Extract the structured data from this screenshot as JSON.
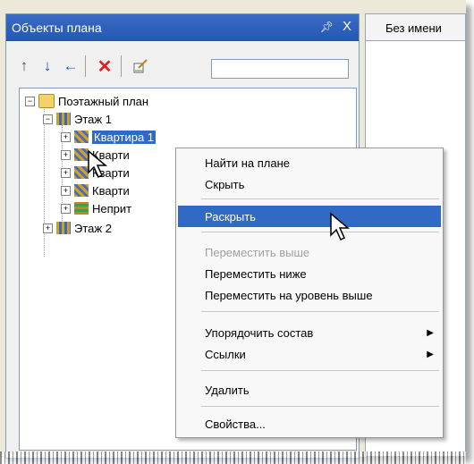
{
  "panel": {
    "title": "Объекты плана",
    "pin_icon": "pin-icon",
    "close_glyph": "X",
    "search_value": ""
  },
  "toolbar": {
    "buttons": [
      "move-up-icon",
      "move-down-icon",
      "move-left-icon",
      "delete-icon",
      "properties-icon"
    ]
  },
  "tree": {
    "root": "Поэтажный план",
    "floor1": "Этаж 1",
    "items": [
      "Квартира 1",
      "Кварти",
      "Кварти",
      "Кварти",
      "Неприт"
    ],
    "floor2": "Этаж 2"
  },
  "document_tab": {
    "label": "Без имени"
  },
  "context_menu": {
    "items": [
      {
        "label": "Найти на плане",
        "state": "normal"
      },
      {
        "label": "Скрыть",
        "state": "normal"
      },
      {
        "label": "Раскрыть",
        "state": "highlighted"
      },
      {
        "label": "Переместить выше",
        "state": "disabled"
      },
      {
        "label": "Переместить ниже",
        "state": "normal"
      },
      {
        "label": "Переместить на уровень выше",
        "state": "normal"
      },
      {
        "label": "Упорядочить состав",
        "state": "submenu"
      },
      {
        "label": "Ссылки",
        "state": "submenu"
      },
      {
        "label": "Удалить",
        "state": "normal"
      },
      {
        "label": "Свойства...",
        "state": "normal"
      }
    ]
  },
  "colors": {
    "selection": "#316ac5",
    "title_bar": "#2456b4"
  }
}
